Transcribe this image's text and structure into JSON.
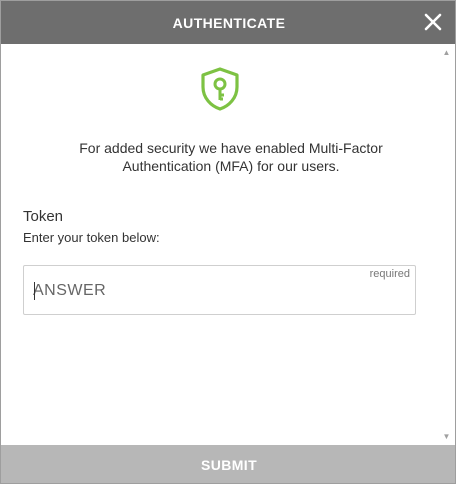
{
  "dialog": {
    "title": "AUTHENTICATE",
    "close_icon": "close-icon",
    "header_color": "#6e6e6e"
  },
  "content": {
    "icon": "shield-key-icon",
    "icon_color": "#7dc243",
    "intro_line1": "For added security we have enabled Multi-Factor",
    "intro_line2": "Authentication (MFA) for our users."
  },
  "token_field": {
    "title": "Token",
    "hint": "Enter your token below:",
    "required_label": "required",
    "placeholder": "ANSWER",
    "value": ""
  },
  "footer": {
    "submit_label": "SUBMIT",
    "submit_color": "#b7b7b7"
  }
}
